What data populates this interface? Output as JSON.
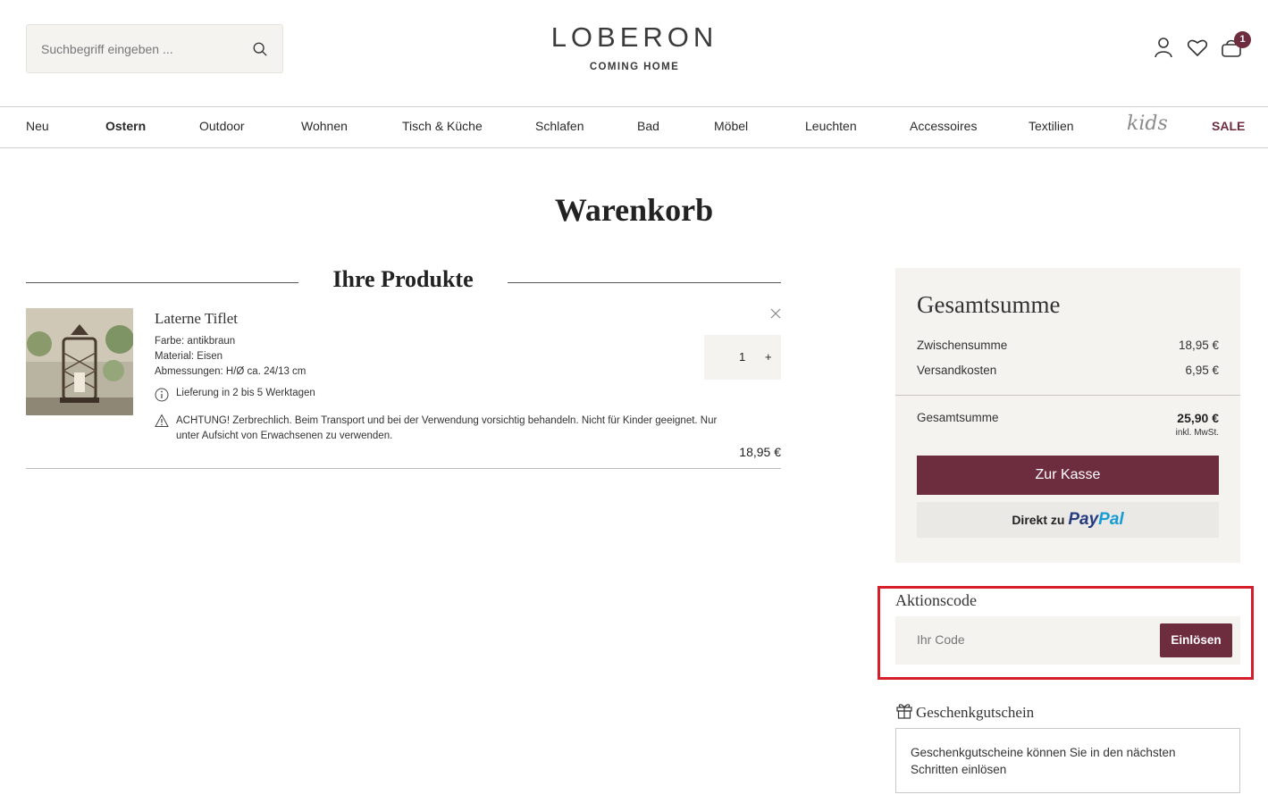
{
  "header": {
    "search_placeholder": "Suchbegriff eingeben ...",
    "brand": "LOBERON",
    "tagline": "COMING HOME",
    "cart_count": "1"
  },
  "nav": {
    "items": [
      "Neu",
      "Ostern",
      "Outdoor",
      "Wohnen",
      "Tisch & Küche",
      "Schlafen",
      "Bad",
      "Möbel",
      "Leuchten",
      "Accessoires",
      "Textilien",
      "kids",
      "SALE"
    ]
  },
  "page": {
    "title": "Warenkorb",
    "products_heading": "Ihre Produkte"
  },
  "product": {
    "name": "Laterne Tiflet",
    "color": "Farbe: antikbraun",
    "material": "Material: Eisen",
    "dimensions": "Abmessungen: H/Ø ca. 24/13 cm",
    "delivery": "Lieferung in 2 bis 5 Werktagen",
    "warning": "ACHTUNG! Zerbrechlich. Beim Transport und bei der Verwendung vorsichtig behandeln. Nicht für Kinder geeignet. Nur unter Aufsicht von Erwachsenen zu verwenden.",
    "quantity": "1",
    "plus": "+",
    "price": "18,95 €"
  },
  "summary": {
    "title": "Gesamtsumme",
    "subtotal_label": "Zwischensumme",
    "subtotal_value": "18,95 €",
    "shipping_label": "Versandkosten",
    "shipping_value": "6,95 €",
    "total_label": "Gesamtsumme",
    "total_value": "25,90 €",
    "vat_note": "inkl. MwSt.",
    "checkout_label": "Zur Kasse",
    "paypal_prefix": "Direkt zu",
    "paypal_brand_1": "Pay",
    "paypal_brand_2": "Pal"
  },
  "promo": {
    "title": "Aktionscode",
    "placeholder": "Ihr Code",
    "redeem_label": "Einlösen"
  },
  "gift": {
    "title": "Geschenkgutschein",
    "text": "Geschenkgutscheine können Sie in den nächsten Schritten einlösen"
  },
  "colors": {
    "accent": "#6e2c3f",
    "panel": "#f5f3f0",
    "highlight": "#d61f2a"
  }
}
